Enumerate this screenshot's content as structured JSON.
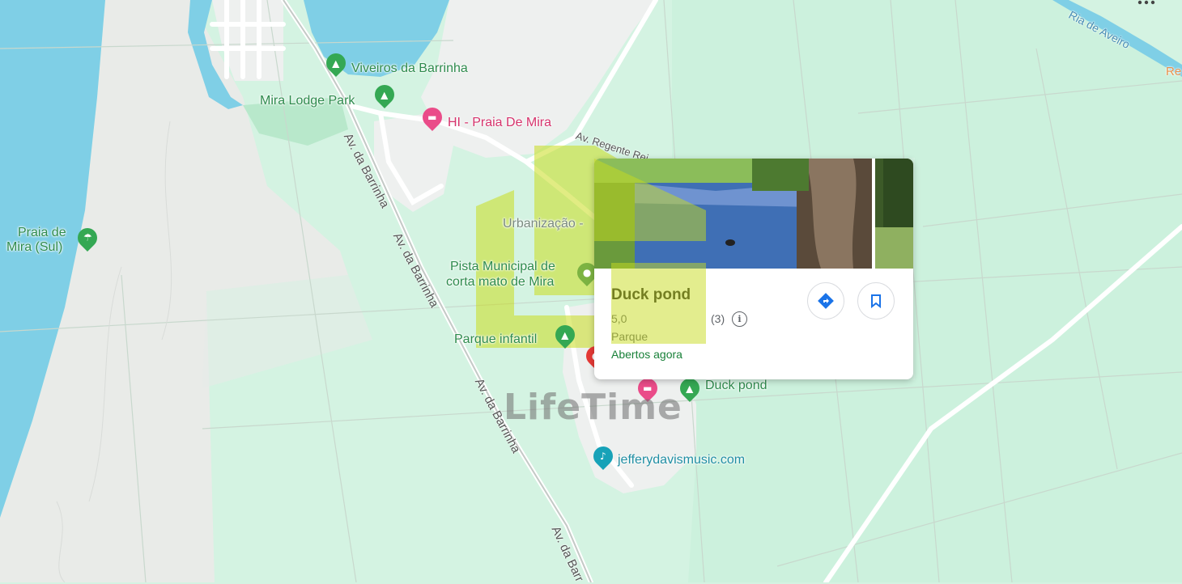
{
  "map": {
    "places": {
      "viveiros": "Viveiros da Barrinha",
      "mira_lodge": "Mira Lodge Park",
      "hi_praia": "HI - Praia De Mira",
      "praia_sul": [
        "Praia de",
        "Mira (Sul)"
      ],
      "urbanizacao": "Urbanização -",
      "pista": [
        "Pista Municipal de",
        "corta mato de Mira"
      ],
      "parque_infantil": "Parque infantil",
      "duck_pond": "Duck pond",
      "jeffery": "jefferydavismusic.com"
    },
    "roads": {
      "barrinha_1": "Av. da Barrinha",
      "barrinha_2": "Av. da Barrinha",
      "barrinha_3": "Av. da Barrinha",
      "barrinha_4": "Av. da Barr",
      "regente": "Av. Regente Rei",
      "ria": "Ria de Aveiro",
      "edge_re": "Re"
    },
    "icons": {
      "park": "tree-icon",
      "camping": "tent-icon",
      "hotel": "bed-icon",
      "beach": "umbrella-icon",
      "music": "music-note-icon"
    },
    "colors": {
      "water": "#7fcfe6",
      "park": "#c9efd8",
      "land": "#d4f3e2",
      "sand": "#e9ebe8",
      "road": "#ffffff"
    }
  },
  "place_card": {
    "title": "Duck pond",
    "rating": "5,0",
    "review_count": "(3)",
    "category": "Parque",
    "open_status": "Abertos agora",
    "directions_label": "directions-icon",
    "save_label": "bookmark-icon"
  },
  "watermark": {
    "text": "LifeTime"
  }
}
